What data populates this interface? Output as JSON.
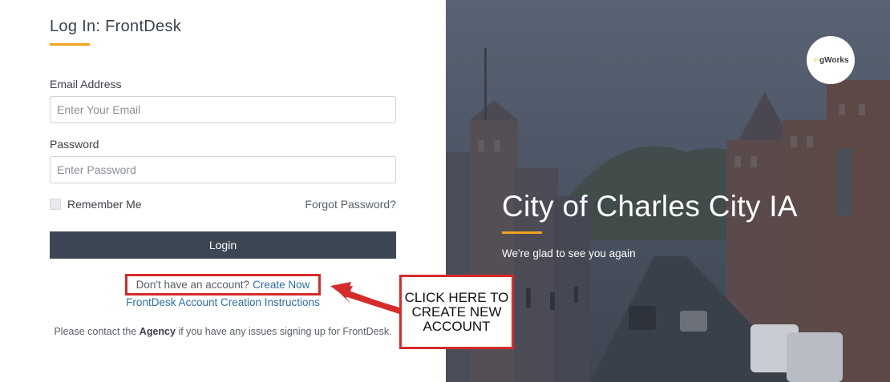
{
  "login": {
    "title": "Log In: FrontDesk",
    "email_label": "Email Address",
    "email_placeholder": "Enter Your Email",
    "password_label": "Password",
    "password_placeholder": "Enter Password",
    "remember_label": "Remember Me",
    "forgot_label": "Forgot Password?",
    "login_button": "Login",
    "no_account_text": "Don't have an account?",
    "create_now": "Create Now",
    "instructions_link": "FrontDesk Account Creation Instructions",
    "contact_prefix": "Please contact the",
    "contact_agency": "Agency",
    "contact_suffix": "if you have any issues signing up for FrontDesk."
  },
  "hero": {
    "city_title": "City of Charles City IA",
    "subtitle": "We're glad to see you again",
    "logo_text": "gWorks"
  },
  "annotation": {
    "callout_text": "CLICK HERE TO CREATE NEW ACCOUNT"
  },
  "colors": {
    "accent": "#f0a21f",
    "button": "#3d4655",
    "link": "#2d6fa6",
    "annotation_red": "#d52b2b"
  }
}
